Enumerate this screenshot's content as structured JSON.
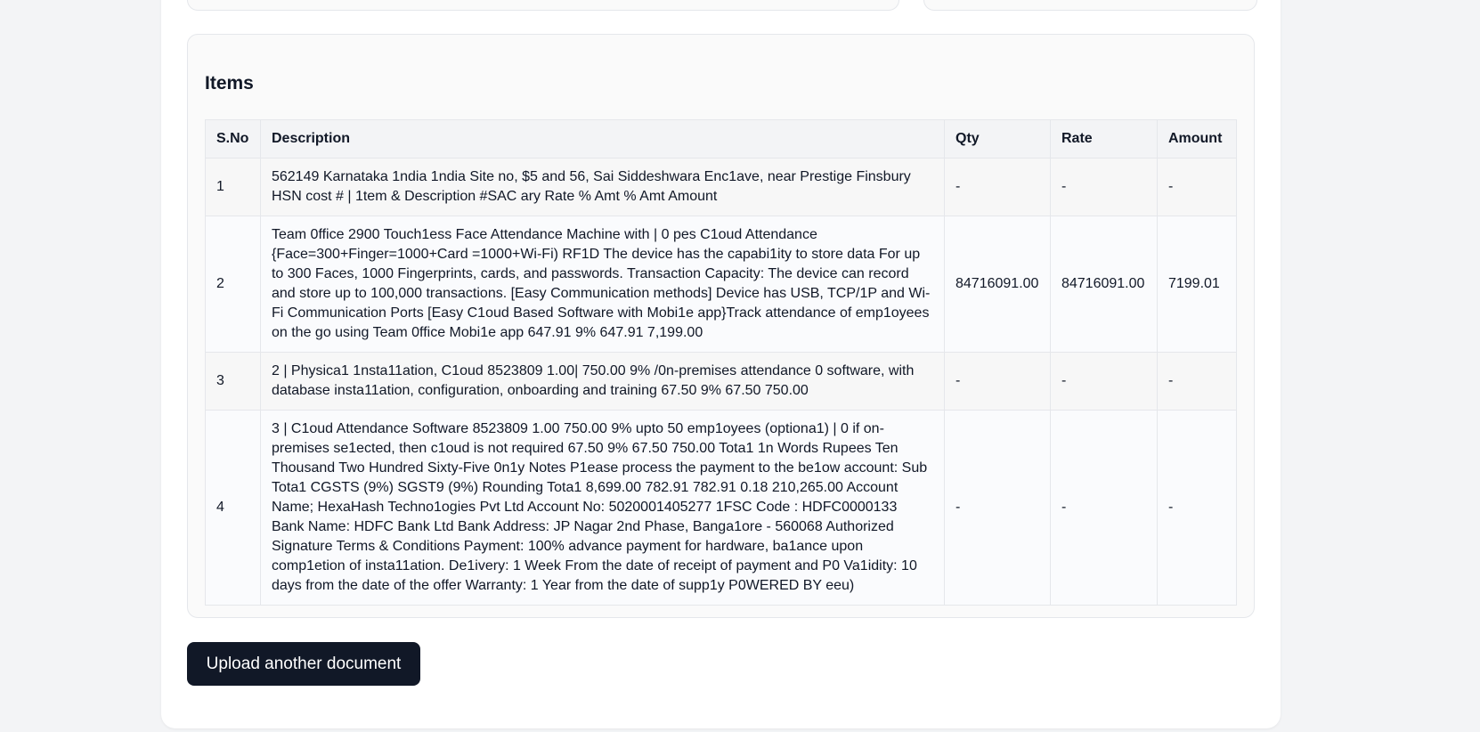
{
  "items": {
    "title": "Items",
    "columns": {
      "sno": "S.No",
      "description": "Description",
      "qty": "Qty",
      "rate": "Rate",
      "amount": "Amount"
    },
    "rows": [
      {
        "sno": "1",
        "description": "562149 Karnataka 1ndia 1ndia Site no, $5 and 56, Sai Siddeshwara Enc1ave, near Prestige Finsbury HSN cost # | 1tem & Description #SAC ary Rate % Amt % Amt Amount",
        "qty": "-",
        "rate": "-",
        "amount": "-"
      },
      {
        "sno": "2",
        "description": "Team 0ffice 2900 Touch1ess Face Attendance Machine with | 0 pes C1oud Attendance {Face=300+Finger=1000+Card =1000+Wi-Fi) RF1D The device has the capabi1ity to store data For up to 300 Faces, 1000 Fingerprints, cards, and passwords. Transaction Capacity: The device can record and store up to 100,000 transactions. [Easy Communication methods] Device has USB, TCP/1P and Wi-Fi Communication Ports [Easy C1oud Based Software with Mobi1e app}Track attendance of emp1oyees on the go using Team 0ffice Mobi1e app 647.91 9% 647.91 7,199.00",
        "qty": "84716091.00",
        "rate": "84716091.00",
        "amount": "7199.01"
      },
      {
        "sno": "3",
        "description": "2 | Physica1 1nsta11ation, C1oud 8523809 1.00| 750.00 9% /0n-premises attendance 0 software, with database insta11ation, configuration, onboarding and training 67.50 9% 67.50 750.00",
        "qty": "-",
        "rate": "-",
        "amount": "-"
      },
      {
        "sno": "4",
        "description": "3 | C1oud Attendance Software 8523809 1.00 750.00 9% upto 50 emp1oyees (optiona1) | 0 if on-premises se1ected, then c1oud is not required 67.50 9% 67.50 750.00 Tota1 1n Words Rupees Ten Thousand Two Hundred Sixty-Five 0n1y Notes P1ease process the payment to the be1ow account: Sub Tota1 CGSTS (9%) SGST9 (9%) Rounding Tota1 8,699.00 782.91 782.91 0.18 210,265.00 Account Name; HexaHash Techno1ogies Pvt Ltd Account No: 5020001405277 1FSC Code : HDFC0000133 Bank Name: HDFC Bank Ltd Bank Address: JP Nagar 2nd Phase, Banga1ore - 560068 Authorized Signature Terms & Conditions Payment: 100% advance payment for hardware, ba1ance upon comp1etion of insta11ation. De1ivery: 1 Week From the date of receipt of payment and P0 Va1idity: 10 days from the date of the offer Warranty: 1 Year from the date of supp1y P0WERED BY eeu)",
        "qty": "-",
        "rate": "-",
        "amount": "-"
      }
    ]
  },
  "actions": {
    "upload_another": "Upload another document"
  }
}
